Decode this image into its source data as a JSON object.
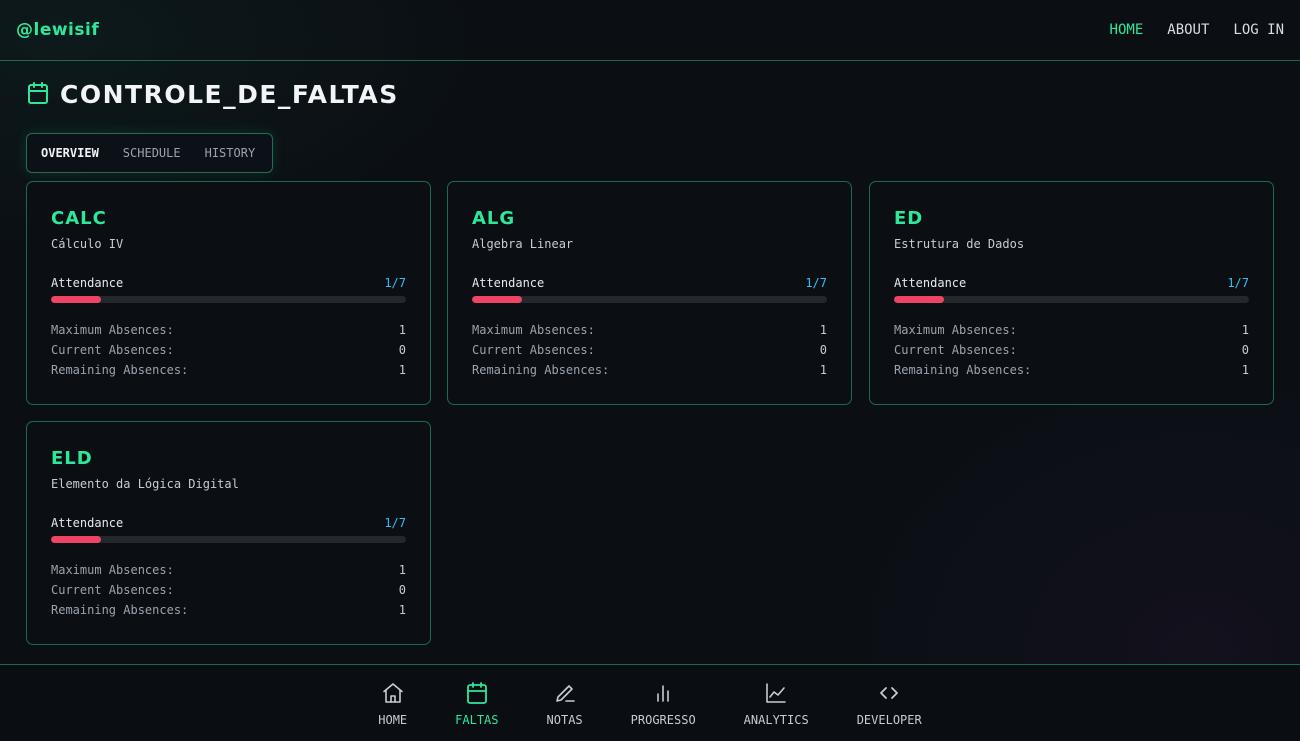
{
  "brand": "@lewisif",
  "topnav": [
    {
      "label": "HOME",
      "active": true
    },
    {
      "label": "ABOUT",
      "active": false
    },
    {
      "label": "LOG IN",
      "active": false
    }
  ],
  "page": {
    "title": "CONTROLE_DE_FALTAS",
    "icon": "calendar-icon"
  },
  "tabs": [
    {
      "label": "OVERVIEW",
      "active": true
    },
    {
      "label": "SCHEDULE",
      "active": false
    },
    {
      "label": "HISTORY",
      "active": false
    }
  ],
  "cards": [
    {
      "code": "CALC",
      "name": "Cálculo IV",
      "attendance_label": "Attendance",
      "attendance": "1/7",
      "progress": 0.14,
      "stats": [
        {
          "label": "Maximum Absences:",
          "value": "1"
        },
        {
          "label": "Current Absences:",
          "value": "0"
        },
        {
          "label": "Remaining Absences:",
          "value": "1"
        }
      ]
    },
    {
      "code": "ALG",
      "name": "Algebra Linear",
      "attendance_label": "Attendance",
      "attendance": "1/7",
      "progress": 0.14,
      "stats": [
        {
          "label": "Maximum Absences:",
          "value": "1"
        },
        {
          "label": "Current Absences:",
          "value": "0"
        },
        {
          "label": "Remaining Absences:",
          "value": "1"
        }
      ]
    },
    {
      "code": "ED",
      "name": "Estrutura de Dados",
      "attendance_label": "Attendance",
      "attendance": "1/7",
      "progress": 0.14,
      "stats": [
        {
          "label": "Maximum Absences:",
          "value": "1"
        },
        {
          "label": "Current Absences:",
          "value": "0"
        },
        {
          "label": "Remaining Absences:",
          "value": "1"
        }
      ]
    },
    {
      "code": "ELD",
      "name": "Elemento da Lógica Digital",
      "attendance_label": "Attendance",
      "attendance": "1/7",
      "progress": 0.14,
      "stats": [
        {
          "label": "Maximum Absences:",
          "value": "1"
        },
        {
          "label": "Current Absences:",
          "value": "0"
        },
        {
          "label": "Remaining Absences:",
          "value": "1"
        }
      ]
    }
  ],
  "bottomnav": [
    {
      "label": "HOME",
      "icon": "home-icon",
      "active": false
    },
    {
      "label": "FALTAS",
      "icon": "calendar-icon",
      "active": true
    },
    {
      "label": "NOTAS",
      "icon": "pencil-icon",
      "active": false
    },
    {
      "label": "PROGRESSO",
      "icon": "bar-chart-icon",
      "active": false
    },
    {
      "label": "ANALYTICS",
      "icon": "line-chart-icon",
      "active": false
    },
    {
      "label": "DEVELOPER",
      "icon": "code-icon",
      "active": false
    }
  ],
  "colors": {
    "accent": "#2ee89a",
    "progress": "#ef4466",
    "attendance": "#38bdf8",
    "border": "#1e6a50"
  }
}
